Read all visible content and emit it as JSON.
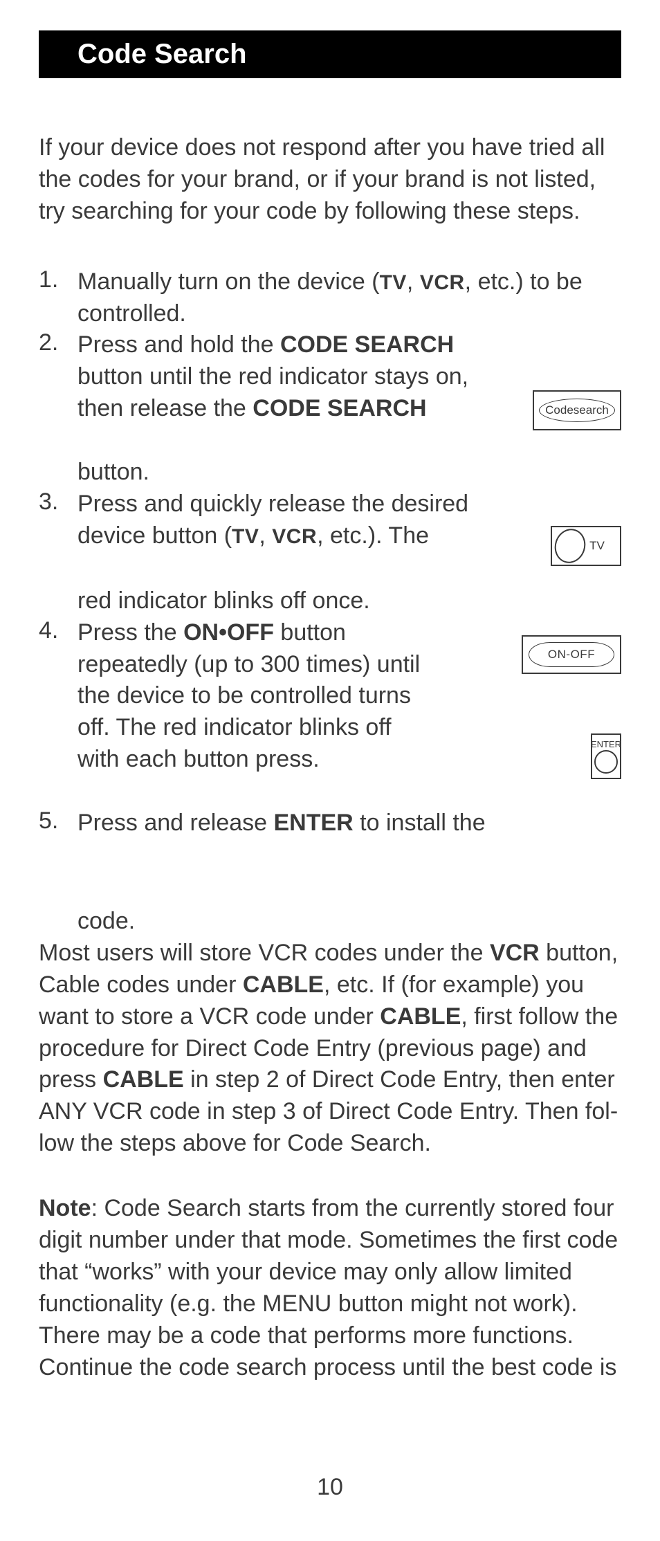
{
  "title": "Code Search",
  "intro": "If your device does not respond after you have tried all the codes for your brand, or if your brand is not listed, try searching for your code by following these steps.",
  "steps": {
    "s1": {
      "num": "1.",
      "a": "Manually turn on the device (",
      "tv": "TV",
      "sep1": ", ",
      "vcr": "VCR",
      "b": ", etc.) to be controlled."
    },
    "s2": {
      "num": "2.",
      "a": "Press and hold the ",
      "cs1": "CODE SEARCH",
      "b": " button until the red indicator stays on, then release the ",
      "cs2": "CODE SEARCH",
      "c": "button."
    },
    "s3": {
      "num": "3.",
      "a": "Press and quickly release the desired device button (",
      "tv": "TV",
      "sep1": ", ",
      "vcr": "VCR",
      "b": ", etc.). The",
      "c": "red indicator blinks off once."
    },
    "s4": {
      "num": "4.",
      "a": "Press the ",
      "onoff": "ON•OFF",
      "b": " button repeatedly (up to 300 times) until the device to be controlled turns off. The red indicator blinks off with each button press."
    },
    "s5": {
      "num": "5.",
      "a": "Press and release ",
      "enter": "ENTER",
      "b": " to install the",
      "c": "code."
    }
  },
  "para": {
    "a": "Most users will store VCR codes under the ",
    "vcr": "VCR",
    "b": " button, Cable codes under ",
    "cable1": "CABLE",
    "c": ", etc. If (for example) you want to store a VCR code under ",
    "cable2": "CABLE",
    "d": ", first follow the procedure for Direct Code Entry (previous page) and press ",
    "cable3": "CABLE",
    "e": " in step 2 of Direct Code Entry, then enter ANY VCR code in step 3 of Direct Code Entry. Then fol­low the steps above for Code Search."
  },
  "note": {
    "label": "Note",
    "text": ":  Code Search starts from the currently stored four digit number under that mode. Sometimes the first code that “works” with your device may only allow limited functionality (e.g. the MENU button might not work). There may be a code that performs more functions. Continue the code search process until the best code is"
  },
  "icons": {
    "codesearch": "Codesearch",
    "tv": "TV",
    "onoff": "ON-OFF",
    "enter": "ENTER"
  },
  "pagenum": "10"
}
